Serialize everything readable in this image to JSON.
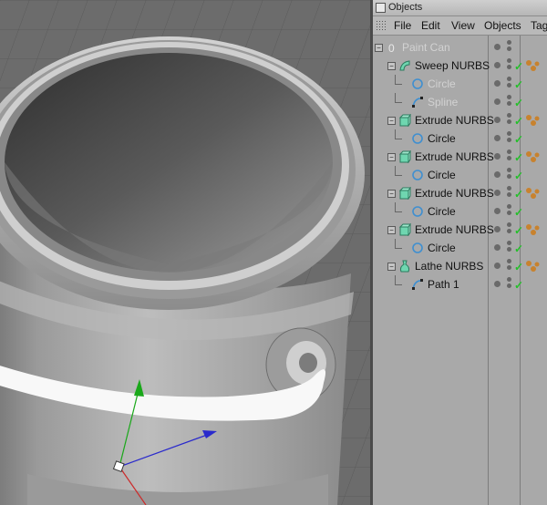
{
  "panel": {
    "title": "Objects",
    "menu": [
      "File",
      "Edit",
      "View",
      "Objects",
      "Tag"
    ]
  },
  "tree": [
    {
      "label": "Paint Can",
      "depth": 0,
      "icon": "null-object-icon",
      "disabled": true,
      "expanded": true,
      "check": false,
      "tag": false
    },
    {
      "label": "Sweep NURBS",
      "depth": 1,
      "icon": "sweep-nurbs-icon",
      "disabled": false,
      "expanded": true,
      "check": true,
      "tag": true
    },
    {
      "label": "Circle",
      "depth": 2,
      "icon": "circle-spline-icon",
      "disabled": true,
      "expanded": false,
      "check": true,
      "tag": false
    },
    {
      "label": "Spline",
      "depth": 2,
      "icon": "spline-icon",
      "disabled": true,
      "expanded": false,
      "check": true,
      "tag": false
    },
    {
      "label": "Extrude NURBS",
      "depth": 1,
      "icon": "extrude-nurbs-icon",
      "disabled": false,
      "expanded": true,
      "check": true,
      "tag": true
    },
    {
      "label": "Circle",
      "depth": 2,
      "icon": "circle-spline-icon",
      "disabled": false,
      "expanded": false,
      "check": true,
      "tag": false
    },
    {
      "label": "Extrude NURBS",
      "depth": 1,
      "icon": "extrude-nurbs-icon",
      "disabled": false,
      "expanded": true,
      "check": true,
      "tag": true
    },
    {
      "label": "Circle",
      "depth": 2,
      "icon": "circle-spline-icon",
      "disabled": false,
      "expanded": false,
      "check": true,
      "tag": false
    },
    {
      "label": "Extrude NURBS",
      "depth": 1,
      "icon": "extrude-nurbs-icon",
      "disabled": false,
      "expanded": true,
      "check": true,
      "tag": true
    },
    {
      "label": "Circle",
      "depth": 2,
      "icon": "circle-spline-icon",
      "disabled": false,
      "expanded": false,
      "check": true,
      "tag": false
    },
    {
      "label": "Extrude NURBS",
      "depth": 1,
      "icon": "extrude-nurbs-icon",
      "disabled": false,
      "expanded": true,
      "check": true,
      "tag": true
    },
    {
      "label": "Circle",
      "depth": 2,
      "icon": "circle-spline-icon",
      "disabled": false,
      "expanded": false,
      "check": true,
      "tag": false
    },
    {
      "label": "Lathe NURBS",
      "depth": 1,
      "icon": "lathe-nurbs-icon",
      "disabled": false,
      "expanded": true,
      "check": true,
      "tag": true
    },
    {
      "label": "Path 1",
      "depth": 2,
      "icon": "spline-icon",
      "disabled": false,
      "expanded": false,
      "check": true,
      "tag": false
    }
  ],
  "colors": {
    "check": "#24c02a",
    "nurbs_icon": "#6fd6b0",
    "spline_icon": "#3f8fd0",
    "tag": "#c8822e",
    "axis_x": "#2a2acc",
    "axis_y": "#1aa81a",
    "axis_z": "#cc2a2a"
  }
}
